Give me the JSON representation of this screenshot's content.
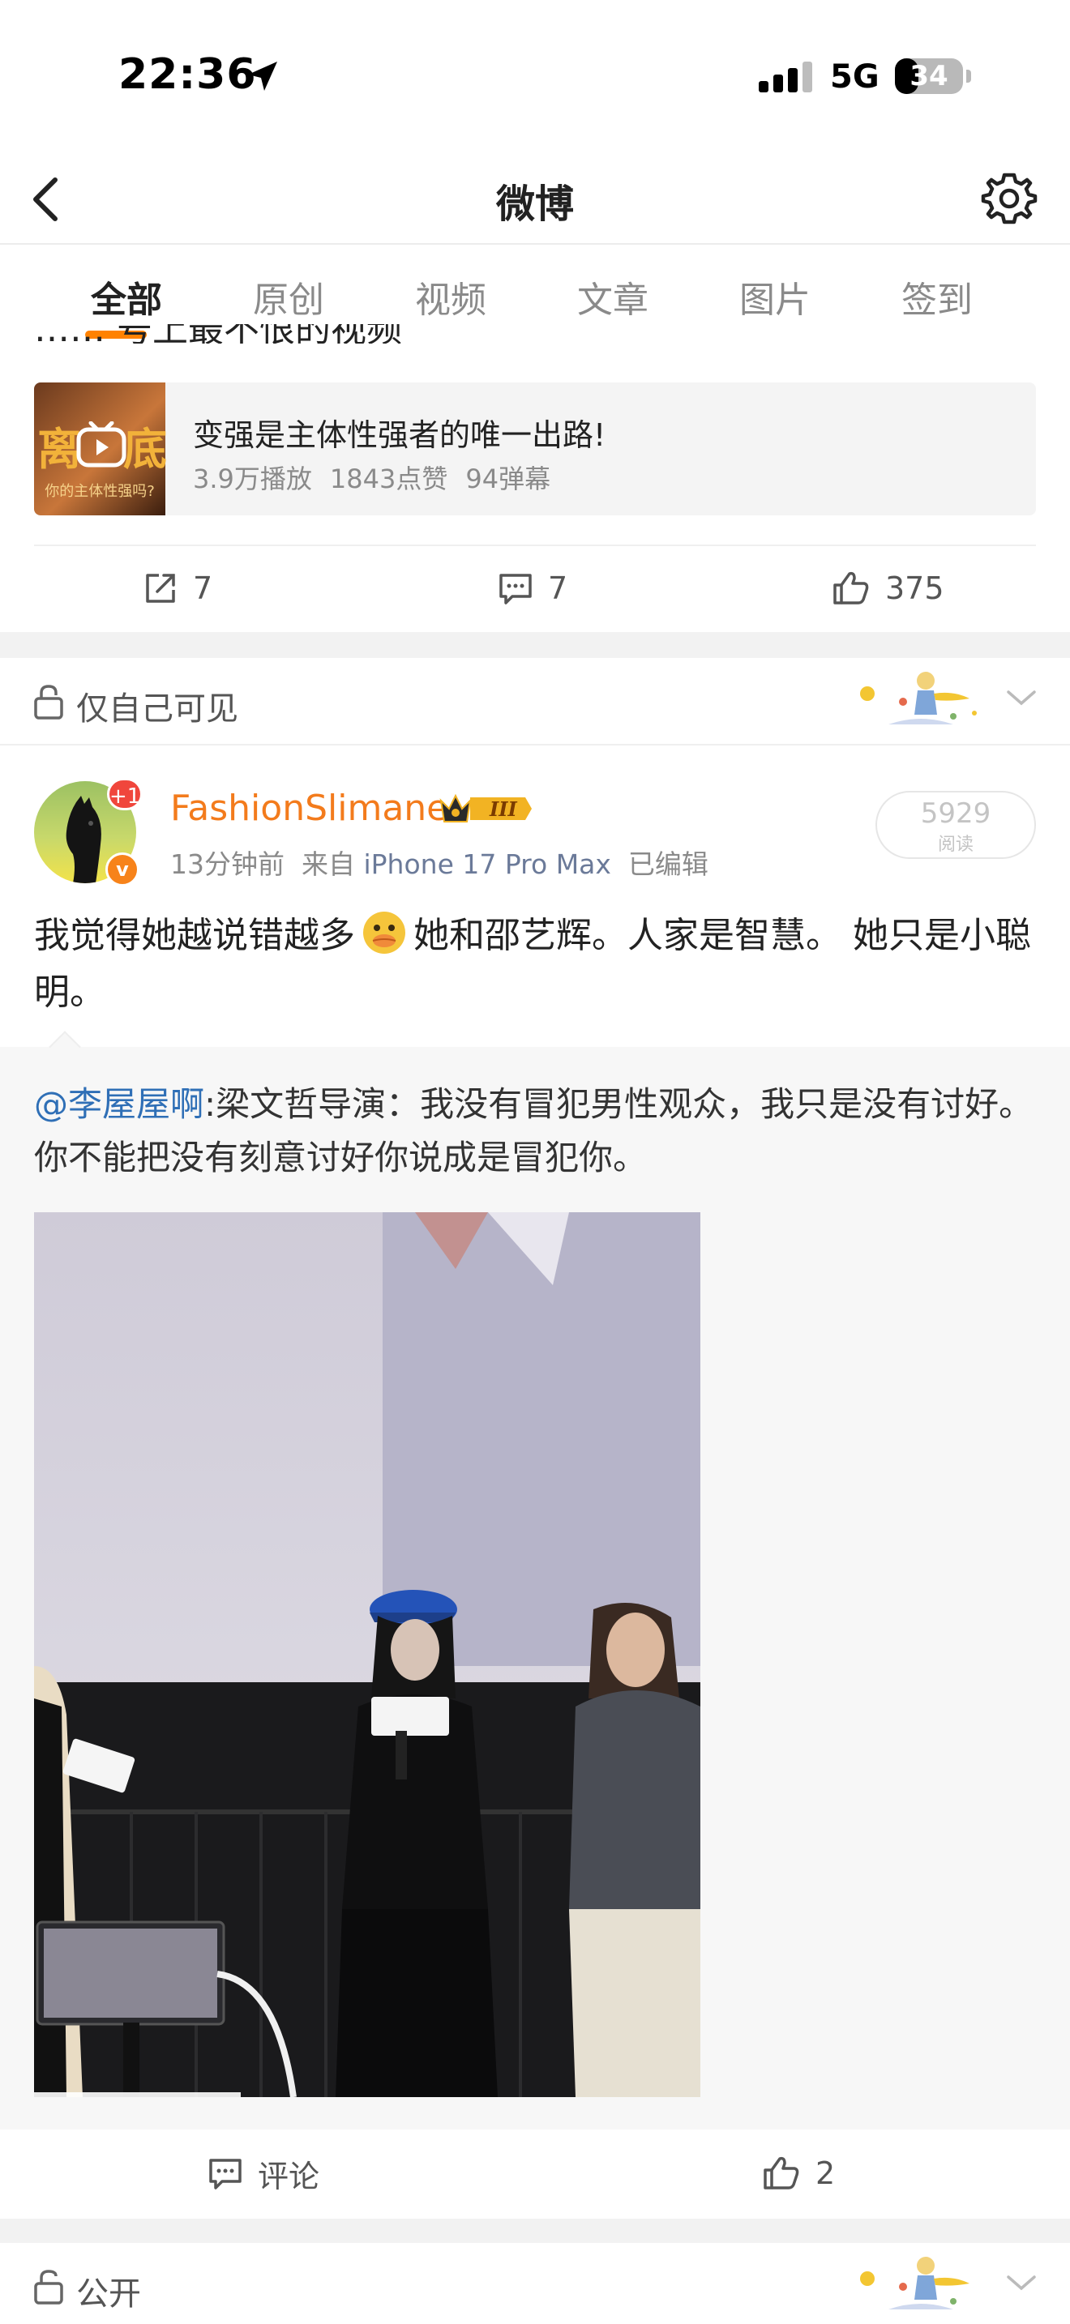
{
  "status_bar": {
    "time": "22:36",
    "network": "5G",
    "battery": "34",
    "battery_level": 0.34
  },
  "nav": {
    "title": "微博"
  },
  "tabs": [
    {
      "label": "全部",
      "active": true
    },
    {
      "label": "原创",
      "active": false
    },
    {
      "label": "视频",
      "active": false
    },
    {
      "label": "文章",
      "active": false
    },
    {
      "label": "图片",
      "active": false
    },
    {
      "label": "签到",
      "active": false
    }
  ],
  "prev_post": {
    "clipped_text": "…… 号上最不恨的视频",
    "video_card": {
      "thumb_left": "离",
      "thumb_right": "底",
      "thumb_sub": "你的主体性强吗?",
      "title": "变强是主体性强者的唯一出路!",
      "plays": "3.9万播放",
      "likes": "1843点赞",
      "danmaku": "94弹幕"
    },
    "actions": {
      "reposts": "7",
      "comments": "7",
      "likes": "375"
    }
  },
  "post": {
    "visibility": "仅自己可见",
    "author": {
      "name": "FashionSlimane",
      "badge_plus": "+1",
      "badge_v": "v",
      "crown_level": "III"
    },
    "time_ago": "13分钟前",
    "source_prefix": "来自",
    "device": "iPhone 17 Pro Max",
    "edited": "已编辑",
    "reads": "5929",
    "reads_label": "阅读",
    "text_before_emoji": "我觉得她越说错越多",
    "text_after_emoji": "她和邵艺辉。人家是智慧。 她只是小聪明。",
    "emoji_name": "duck-emoji",
    "repost": {
      "mention": "@李屋屋啊",
      "text": ":梁文哲导演：我没有冒犯男性观众，我只是没有讨好。你不能把没有刻意讨好你说成是冒犯你。",
      "image_alt": "photo-of-people-on-stage",
      "progress": 0.31
    },
    "actions": {
      "comment_label": "评论",
      "likes": "2"
    }
  },
  "next_post": {
    "visibility": "公开"
  }
}
